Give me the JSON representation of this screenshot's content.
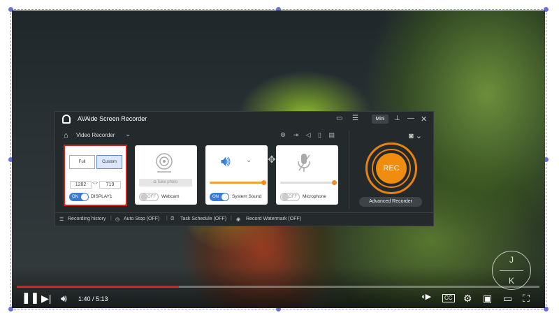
{
  "recorder": {
    "app_title": "AVAide Screen Recorder",
    "mini_label": "Mini",
    "mode_label": "Video Recorder",
    "display": {
      "full_label": "Full",
      "custom_label": "Custom",
      "width": "1282",
      "height": "719",
      "swap_symbol": "<>",
      "toggle_state": "ON",
      "label": "DISPLAY1"
    },
    "webcam": {
      "take_photo_label": "Take photo",
      "toggle_state": "OFF",
      "label": "Webcam"
    },
    "system_sound": {
      "toggle_state": "ON",
      "label": "System Sound",
      "volume_fraction": 0.97
    },
    "microphone": {
      "toggle_state": "OFF",
      "label": "Microphone",
      "volume_fraction": 0.97
    },
    "rec_label": "REC",
    "advanced_label": "Advanced Recorder",
    "footer": {
      "history": "Recording history",
      "auto_stop": "Auto Stop (OFF)",
      "task_schedule": "Task Schedule (OFF)",
      "watermark": "Record Watermark (OFF)"
    }
  },
  "player": {
    "timecode": "1:40 / 5:13",
    "progress_fraction": 0.31,
    "logo_top": "J",
    "logo_bottom": "K"
  },
  "colors": {
    "accent_orange": "#f08c10",
    "toggle_blue": "#3a7bd5",
    "highlight_red": "#e31b1b",
    "progress_red": "#e02020"
  }
}
